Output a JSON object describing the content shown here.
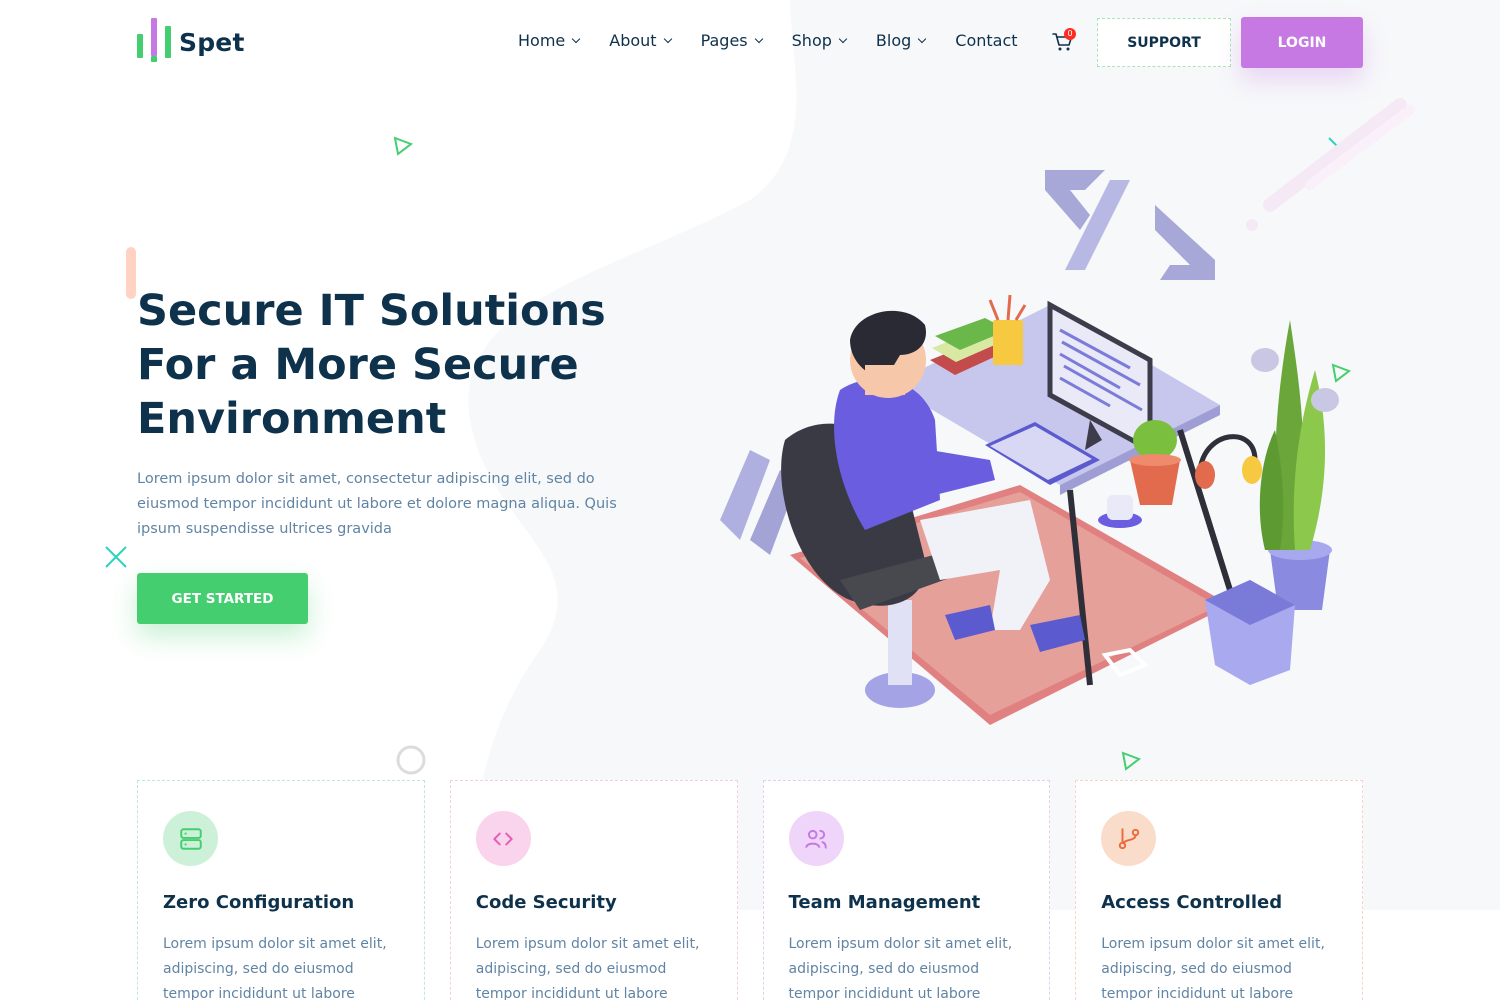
{
  "brand": {
    "name": "Spet",
    "colors": [
      "#44ce6f",
      "#c679e3",
      "#44ce6f"
    ]
  },
  "nav": {
    "items": [
      {
        "label": "Home",
        "dropdown": true
      },
      {
        "label": "About",
        "dropdown": true
      },
      {
        "label": "Pages",
        "dropdown": true
      },
      {
        "label": "Shop",
        "dropdown": true
      },
      {
        "label": "Blog",
        "dropdown": true
      },
      {
        "label": "Contact",
        "dropdown": false
      }
    ],
    "cart_count": "0",
    "cart_icon": "cart-icon",
    "support_label": "SUPPORT",
    "login_label": "LOGIN"
  },
  "hero": {
    "title": "Secure IT Solutions For a More Secure Environment",
    "text": "Lorem ipsum dolor sit amet, consectetur adipiscing elit, sed do eiusmod tempor incididunt ut labore et dolore magna aliqua. Quis ipsum suspendisse ultrices gravida",
    "cta_label": "GET STARTED"
  },
  "features": [
    {
      "title": "Zero Configuration",
      "text": "Lorem ipsum dolor sit amet elit, adipiscing, sed do eiusmod tempor incididunt ut labore",
      "icon": "server-icon",
      "bg": "#cdf1d8",
      "color": "#44ce6f"
    },
    {
      "title": "Code Security",
      "text": "Lorem ipsum dolor sit amet elit, adipiscing, sed do eiusmod tempor incididunt ut labore",
      "icon": "code-icon",
      "bg": "#f9d4ec",
      "color": "#e45fb3"
    },
    {
      "title": "Team Management",
      "text": "Lorem ipsum dolor sit amet elit, adipiscing, sed do eiusmod tempor incididunt ut labore",
      "icon": "users-icon",
      "bg": "#eed5f9",
      "color": "#c679e3"
    },
    {
      "title": "Access Controlled",
      "text": "Lorem ipsum dolor sit amet elit, adipiscing, sed do eiusmod tempor incididunt ut labore",
      "icon": "git-branch-icon",
      "bg": "#fadccb",
      "color": "#eb6b3d"
    }
  ]
}
